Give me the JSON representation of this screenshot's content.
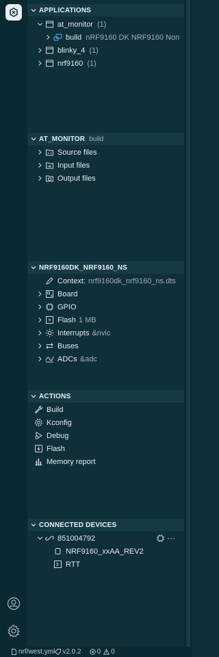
{
  "applications": {
    "header": "APPLICATIONS",
    "items": [
      {
        "label": "at_monitor",
        "count": "(1)"
      },
      {
        "label": "build",
        "detail": "nRF9160 DK NRF9160 Non"
      },
      {
        "label": "blinky_4",
        "count": "(1)"
      },
      {
        "label": "nrf9160",
        "count": "(1)"
      }
    ]
  },
  "app_details": {
    "header": "AT_MONITOR",
    "sub": "build",
    "items": [
      {
        "label": "Source files"
      },
      {
        "label": "Input files"
      },
      {
        "label": "Output files"
      }
    ]
  },
  "devicetree": {
    "header": "NRF9160DK_NRF9160_NS",
    "items": [
      {
        "label": "Context:",
        "detail": "nrf9160dk_nrf9160_ns.dts"
      },
      {
        "label": "Board"
      },
      {
        "label": "GPIO"
      },
      {
        "label": "Flash",
        "detail": "1 MB"
      },
      {
        "label": "Interrupts",
        "detail": "&nvic"
      },
      {
        "label": "Buses"
      },
      {
        "label": "ADCs",
        "detail": "&adc"
      }
    ]
  },
  "actions": {
    "header": "ACTIONS",
    "items": [
      {
        "label": "Build"
      },
      {
        "label": "Kconfig"
      },
      {
        "label": "Debug"
      },
      {
        "label": "Flash"
      },
      {
        "label": "Memory report"
      }
    ]
  },
  "connected_devices": {
    "header": "CONNECTED DEVICES",
    "device": "851004792",
    "more": "···",
    "items": [
      {
        "label": "NRF9160_xxAA_REV2"
      },
      {
        "label": "RTT"
      }
    ]
  },
  "status_bar": {
    "manifest": "nrf/west.yml",
    "version": "v2.0.2",
    "errors": "0",
    "warnings": "0"
  },
  "colors": {
    "background": "#0f2f39",
    "header_bg": "#173b45",
    "activity_bg": "#0b2931",
    "text": "#e2ecef",
    "dim_text": "#9fb2b7"
  }
}
